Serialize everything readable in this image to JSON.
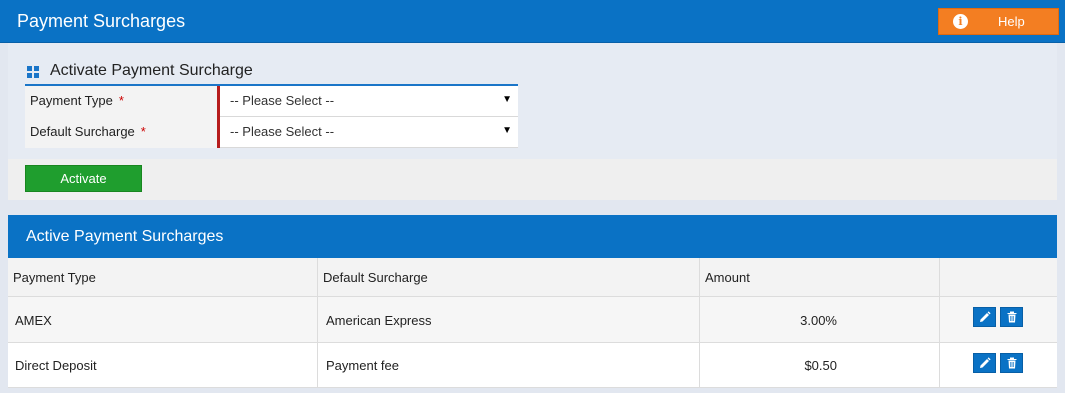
{
  "header": {
    "title": "Payment Surcharges",
    "help_label": "Help",
    "help_icon": "info-icon",
    "accent_color": "#0a72c5",
    "help_color": "#f37e22"
  },
  "activate": {
    "title": "Activate Payment Surcharge",
    "icon": "grid-icon",
    "fields": [
      {
        "label": "Payment Type",
        "required_mark": "*",
        "value": "-- Please Select --"
      },
      {
        "label": "Default Surcharge",
        "required_mark": "*",
        "value": "-- Please Select --"
      }
    ],
    "button_label": "Activate",
    "button_color": "#1f9e2e"
  },
  "active_table": {
    "title": "Active Payment Surcharges",
    "columns": [
      "Payment Type",
      "Default Surcharge",
      "Amount",
      ""
    ],
    "rows": [
      {
        "payment_type": "AMEX",
        "default_surcharge": "American Express",
        "amount": "3.00%"
      },
      {
        "payment_type": "Direct Deposit",
        "default_surcharge": "Payment fee",
        "amount": "$0.50"
      }
    ],
    "row_actions": [
      "pencil-icon",
      "trash-icon"
    ]
  }
}
